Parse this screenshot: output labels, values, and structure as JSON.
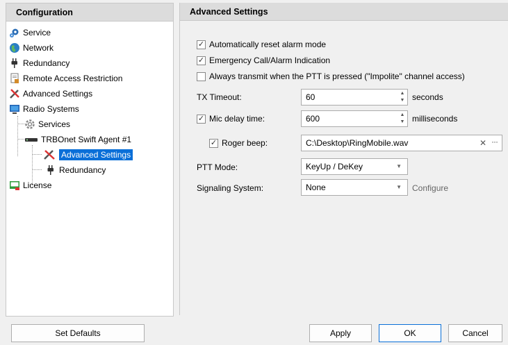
{
  "left_panel": {
    "title": "Configuration",
    "items": [
      {
        "label": "Service",
        "icon": "gear-icon"
      },
      {
        "label": "Network",
        "icon": "globe-icon"
      },
      {
        "label": "Redundancy",
        "icon": "plug-icon"
      },
      {
        "label": "Remote Access Restriction",
        "icon": "document-lock-icon"
      },
      {
        "label": "Advanced Settings",
        "icon": "tools-icon"
      },
      {
        "label": "Radio Systems",
        "icon": "monitor-icon"
      },
      {
        "label": "Services",
        "icon": "gear-icon"
      },
      {
        "label": "TRBOnet Swift Agent #1",
        "icon": "device-icon"
      },
      {
        "label": "Advanced Settings",
        "icon": "tools-icon"
      },
      {
        "label": "Redundancy",
        "icon": "plug-icon"
      },
      {
        "label": "License",
        "icon": "license-icon"
      }
    ]
  },
  "right_panel": {
    "title": "Advanced Settings",
    "auto_reset": {
      "label": "Automatically reset alarm mode",
      "checked": true
    },
    "emergency": {
      "label": "Emergency Call/Alarm Indication",
      "checked": true
    },
    "always_transmit": {
      "label": "Always transmit when the PTT is pressed (\"Impolite\" channel access)",
      "checked": false
    },
    "tx_timeout": {
      "label": "TX Timeout:",
      "value": "60",
      "unit": "seconds"
    },
    "mic_delay": {
      "label": "Mic delay time:",
      "value": "600",
      "unit": "milliseconds",
      "checked": true
    },
    "roger_beep": {
      "label": "Roger beep:",
      "value": "C:\\Desktop\\RingMobile.wav",
      "checked": true
    },
    "ptt_mode": {
      "label": "PTT Mode:",
      "value": "KeyUp / DeKey"
    },
    "signaling": {
      "label": "Signaling System:",
      "value": "None",
      "configure": "Configure"
    }
  },
  "buttons": {
    "set_defaults": "Set Defaults",
    "apply": "Apply",
    "ok": "OK",
    "cancel": "Cancel"
  },
  "check_glyph": "✓"
}
